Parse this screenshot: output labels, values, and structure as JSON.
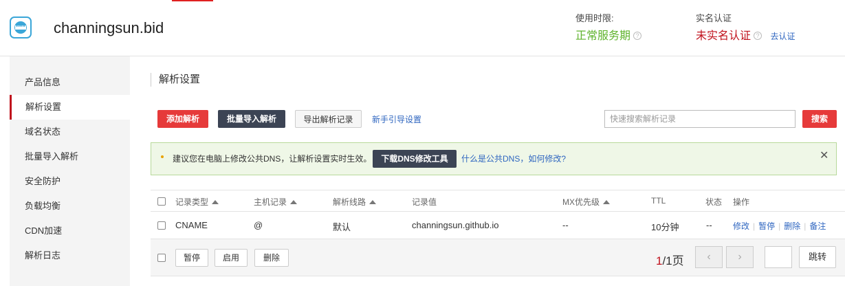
{
  "header": {
    "domain": "channingsun.bid",
    "service_label": "使用时限:",
    "service_value": "正常服务期",
    "realname_label": "实名认证",
    "realname_value": "未实名认证",
    "realname_link": "去认证",
    "help_glyph": "?"
  },
  "sidebar": {
    "items": [
      {
        "label": "产品信息"
      },
      {
        "label": "解析设置"
      },
      {
        "label": "域名状态"
      },
      {
        "label": "批量导入解析"
      },
      {
        "label": "安全防护"
      },
      {
        "label": "负载均衡"
      },
      {
        "label": "CDN加速"
      },
      {
        "label": "解析日志"
      }
    ],
    "active_index": 1
  },
  "main": {
    "title": "解析设置",
    "toolbar": {
      "add": "添加解析",
      "batch_import": "批量导入解析",
      "export": "导出解析记录",
      "guide": "新手引导设置",
      "search_placeholder": "快速搜索解析记录",
      "search_button": "搜索"
    },
    "notice": {
      "text": "建议您在电脑上修改公共DNS，让解析设置实时生效。",
      "download_button": "下载DNS修改工具",
      "link": "什么是公共DNS，如何修改?",
      "close": "✕"
    },
    "table": {
      "headers": {
        "type": "记录类型",
        "host": "主机记录",
        "line": "解析线路",
        "value": "记录值",
        "mx": "MX优先级",
        "ttl": "TTL",
        "status": "状态",
        "ops": "操作"
      },
      "rows": [
        {
          "type": "CNAME",
          "host": "@",
          "line": "默认",
          "value": "channingsun.github.io",
          "mx": "--",
          "ttl": "10分钟",
          "status": "--",
          "ops": [
            "修改",
            "暂停",
            "删除",
            "备注"
          ]
        }
      ]
    },
    "footer": {
      "pause": "暂停",
      "enable": "启用",
      "delete": "删除",
      "page_current": "1",
      "page_total": "/1页",
      "prev": "‹",
      "next": "›",
      "jump": "跳转"
    }
  },
  "colors": {
    "accent_red": "#e63a3a",
    "status_green": "#5fb32c",
    "warning_red": "#c0111c",
    "link_blue": "#2f66c0"
  }
}
